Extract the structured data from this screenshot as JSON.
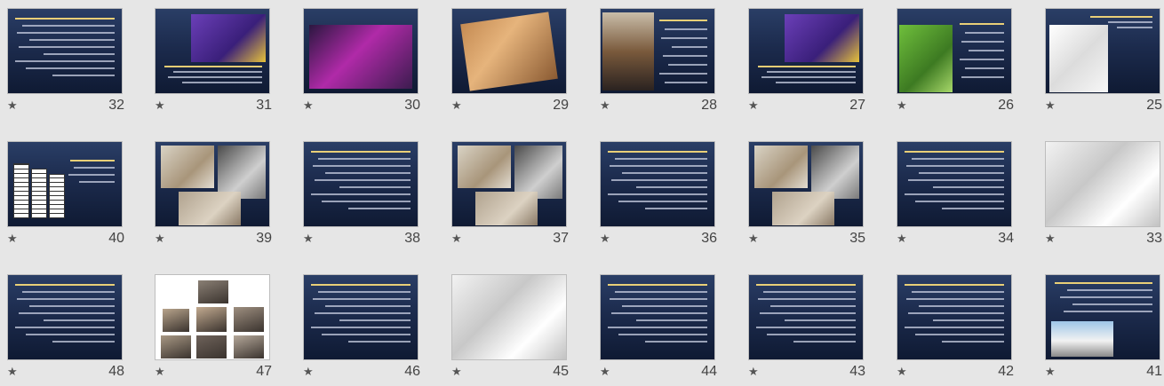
{
  "slides": [
    {
      "num": "32",
      "kind": "text",
      "title": "",
      "row": 0,
      "col": 0
    },
    {
      "num": "31",
      "kind": "photo-text",
      "title": "",
      "row": 0,
      "col": 1
    },
    {
      "num": "30",
      "kind": "photo-title",
      "title": "",
      "row": 0,
      "col": 2
    },
    {
      "num": "29",
      "kind": "photo-tilt",
      "title": "",
      "row": 0,
      "col": 3
    },
    {
      "num": "28",
      "kind": "photo-left-text",
      "title": "",
      "row": 0,
      "col": 4
    },
    {
      "num": "27",
      "kind": "photo-text",
      "title": "",
      "row": 0,
      "col": 5
    },
    {
      "num": "26",
      "kind": "photo-right",
      "title": "",
      "row": 0,
      "col": 6
    },
    {
      "num": "25",
      "kind": "photo-left",
      "title": "",
      "row": 0,
      "col": 7
    },
    {
      "num": "40",
      "kind": "diagram",
      "title": "",
      "row": 1,
      "col": 0
    },
    {
      "num": "39",
      "kind": "photo-grid",
      "title": "",
      "row": 1,
      "col": 1
    },
    {
      "num": "38",
      "kind": "text",
      "title": "",
      "row": 1,
      "col": 2
    },
    {
      "num": "37",
      "kind": "photo-grid",
      "title": "",
      "row": 1,
      "col": 3
    },
    {
      "num": "36",
      "kind": "text",
      "title": "",
      "row": 1,
      "col": 4
    },
    {
      "num": "35",
      "kind": "photo-grid",
      "title": "",
      "row": 1,
      "col": 5
    },
    {
      "num": "34",
      "kind": "text",
      "title": "",
      "row": 1,
      "col": 6
    },
    {
      "num": "33",
      "kind": "photo-full",
      "title": "",
      "row": 1,
      "col": 7
    },
    {
      "num": "48",
      "kind": "text",
      "title": "",
      "row": 2,
      "col": 0
    },
    {
      "num": "47",
      "kind": "photo-collage",
      "title": "",
      "row": 2,
      "col": 1
    },
    {
      "num": "46",
      "kind": "text",
      "title": "",
      "row": 2,
      "col": 2
    },
    {
      "num": "45",
      "kind": "photo-full",
      "title": "",
      "row": 2,
      "col": 3
    },
    {
      "num": "44",
      "kind": "text",
      "title": "",
      "row": 2,
      "col": 4
    },
    {
      "num": "43",
      "kind": "text",
      "title": "",
      "row": 2,
      "col": 5
    },
    {
      "num": "42",
      "kind": "text",
      "title": "",
      "row": 2,
      "col": 6
    },
    {
      "num": "41",
      "kind": "text-photo",
      "title": "",
      "row": 2,
      "col": 7
    }
  ],
  "icons": {
    "star": "star-icon"
  },
  "colors": {
    "background": "#e6e6e6",
    "slide_navy": "#1c2b4d",
    "title_yellow": "#ffd860"
  }
}
